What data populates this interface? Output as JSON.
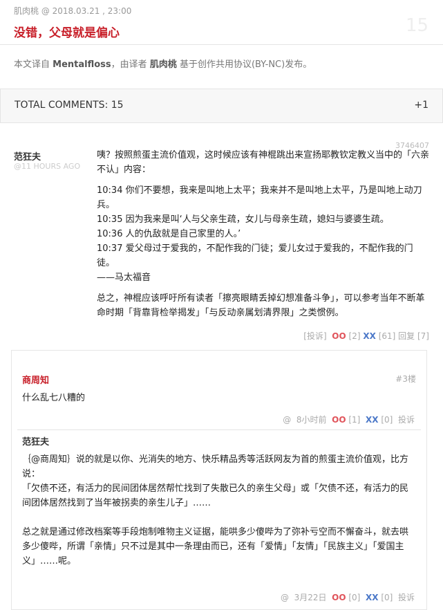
{
  "post": {
    "byline": "肌肉桃 @ 2018.03.21 , 23:00",
    "title": "没错，父母就是偏心",
    "comment_count_big": "15"
  },
  "credit": {
    "prefix": "本文译自",
    "source": "Mentalfloss",
    "middle": "，由译者",
    "translator": "肌肉桃",
    "suffix": "基于创作共用协议(BY-NC)发布。"
  },
  "comments_header": {
    "label": "TOTAL COMMENTS: 15",
    "plus": "+1"
  },
  "comment_main": {
    "id": "3746407",
    "author": "范狂夫",
    "time": "@11 HOURS AGO",
    "lines": [
      "咦？按照煎蛋主流价值观，这时候应该有神棍跳出来宣扬耶教钦定教义当中的「六亲不认」内容：",
      "10:34 你们不要想，我来是叫地上太平；我来并不是叫地上太平，乃是叫地上动刀兵。",
      "10:35 因为我来是叫‘人与父亲生疏，女儿与母亲生疏，媳妇与婆婆生疏。",
      "10:36 人的仇敌就是自己家里的人。’",
      "10:37 爱父母过于爱我的，不配作我的门徒；爱儿女过于爱我的，不配作我的门徒。",
      "——马太福音",
      "总之，神棍应该呼吁所有读者「擦亮眼睛丢掉幻想准备斗争」，可以参考当年不断革命时期「背靠背检举揭发」「与反动亲属划清界限」之类惯例。"
    ],
    "report": "[投诉]",
    "oo": "OO",
    "oo_count": "[2]",
    "xx": "XX",
    "xx_count": "[61]",
    "reply": "回复 [7]"
  },
  "sub_comments": [
    {
      "author": "商周知",
      "floor": "#3楼",
      "text": "什么乱七八糟的",
      "at": "@",
      "time": "8小时前",
      "oo": "OO",
      "oo_count": "[1]",
      "xx": "XX",
      "xx_count": "[0]",
      "report": "投诉"
    },
    {
      "author": "范狂夫",
      "lines": [
        "｛@商周知｝说的就是以你、光消失的地方、快乐精品秀等活跃网友为首的煎蛋主流价值观，比方说：",
        "「欠债不还，有活力的民间团体居然帮忙找到了失散已久的亲生父母」或「欠债不还，有活力的民间团体居然找到了当年被拐卖的亲生儿子」……",
        "总之就是通过修改档案等手段炮制唯物主义证据，能哄多少傻哔为了弥补亏空而不懈奋斗，就去哄多少傻哔，所谓「亲情」只不过是其中一条理由而已，还有「爱情」「友情」「民族主义」「爱国主义」……呢。"
      ],
      "at": "@",
      "time": "3月22日",
      "oo": "OO",
      "oo_count": "[0]",
      "xx": "XX",
      "xx_count": "[0]",
      "report": "投诉"
    }
  ]
}
